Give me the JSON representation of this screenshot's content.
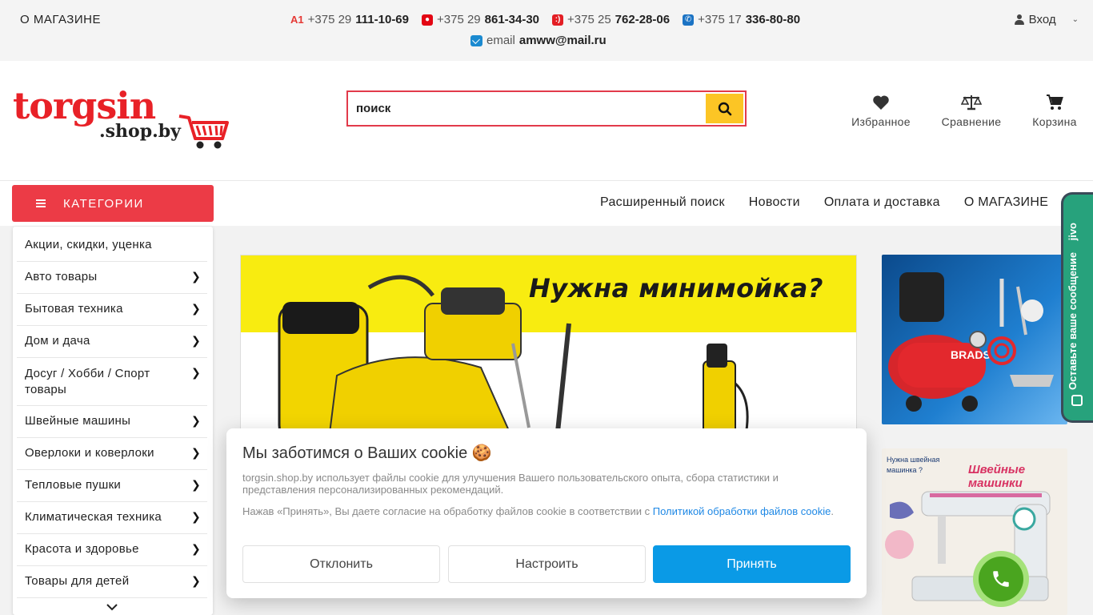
{
  "topbar": {
    "about": "О МАГАЗИНЕ",
    "phones": [
      {
        "operator": "a1",
        "prefix": "+375 29",
        "number": "111-10-69"
      },
      {
        "operator": "mts",
        "prefix": "+375 29",
        "number": "861-34-30"
      },
      {
        "operator": "life",
        "prefix": "+375 25",
        "number": "762-28-06"
      },
      {
        "operator": "city",
        "prefix": "+375 17",
        "number": "336-80-80"
      }
    ],
    "email_label": "email",
    "email": "amww@mail.ru",
    "login": "Вход"
  },
  "header": {
    "logo_main": "torgsin",
    "logo_sub": ".shop.by",
    "search_placeholder": "поиск",
    "favorites": "Избранное",
    "compare": "Сравнение",
    "cart": "Корзина"
  },
  "nav": {
    "categories_button": "КАТЕГОРИИ",
    "links": [
      "Расширенный поиск",
      "Новости",
      "Оплата и доставка",
      "О МАГАЗИНЕ"
    ]
  },
  "categories": [
    {
      "label": "Акции, скидки, уценка",
      "arrow": false
    },
    {
      "label": "Авто товары",
      "arrow": true
    },
    {
      "label": "Бытовая техника",
      "arrow": true
    },
    {
      "label": "Дом и дача",
      "arrow": true
    },
    {
      "label": "Досуг / Хобби / Спорт товары",
      "arrow": true
    },
    {
      "label": "Швейные машины",
      "arrow": true
    },
    {
      "label": "Оверлоки и коверлоки",
      "arrow": true
    },
    {
      "label": "Тепловые пушки",
      "arrow": true
    },
    {
      "label": "Климатическая техника",
      "arrow": true
    },
    {
      "label": "Красота и здоровье",
      "arrow": true
    },
    {
      "label": "Товары для детей",
      "arrow": true
    }
  ],
  "banners": {
    "main_title": "Нужна минимойка?",
    "side1_brand": "BRADS",
    "side2_small": "Нужна швейная машинка ?",
    "side2_title": "Швейные машинки"
  },
  "cookie": {
    "title": "Мы заботимся о Ваших cookie 🍪",
    "text1": "torgsin.shop.by использует файлы cookie для улучшения Вашего пользовательского опыта, сбора статистики и представления персонализированных рекомендаций.",
    "text2": "Нажав «Принять», Вы даете согласие на обработку файлов cookie в соответствии с",
    "link": "Политикой обработки файлов cookie",
    "decline": "Отклонить",
    "setup": "Настроить",
    "accept": "Принять"
  },
  "jivo": {
    "label": "Оставьте ваше сообщение",
    "brand": "jivo"
  },
  "colors": {
    "accent_red": "#ec3b46",
    "search_yellow": "#fcc525",
    "accept_blue": "#0a9ae6",
    "jivo_green": "#27a27c",
    "call_green": "#4aa51f"
  }
}
